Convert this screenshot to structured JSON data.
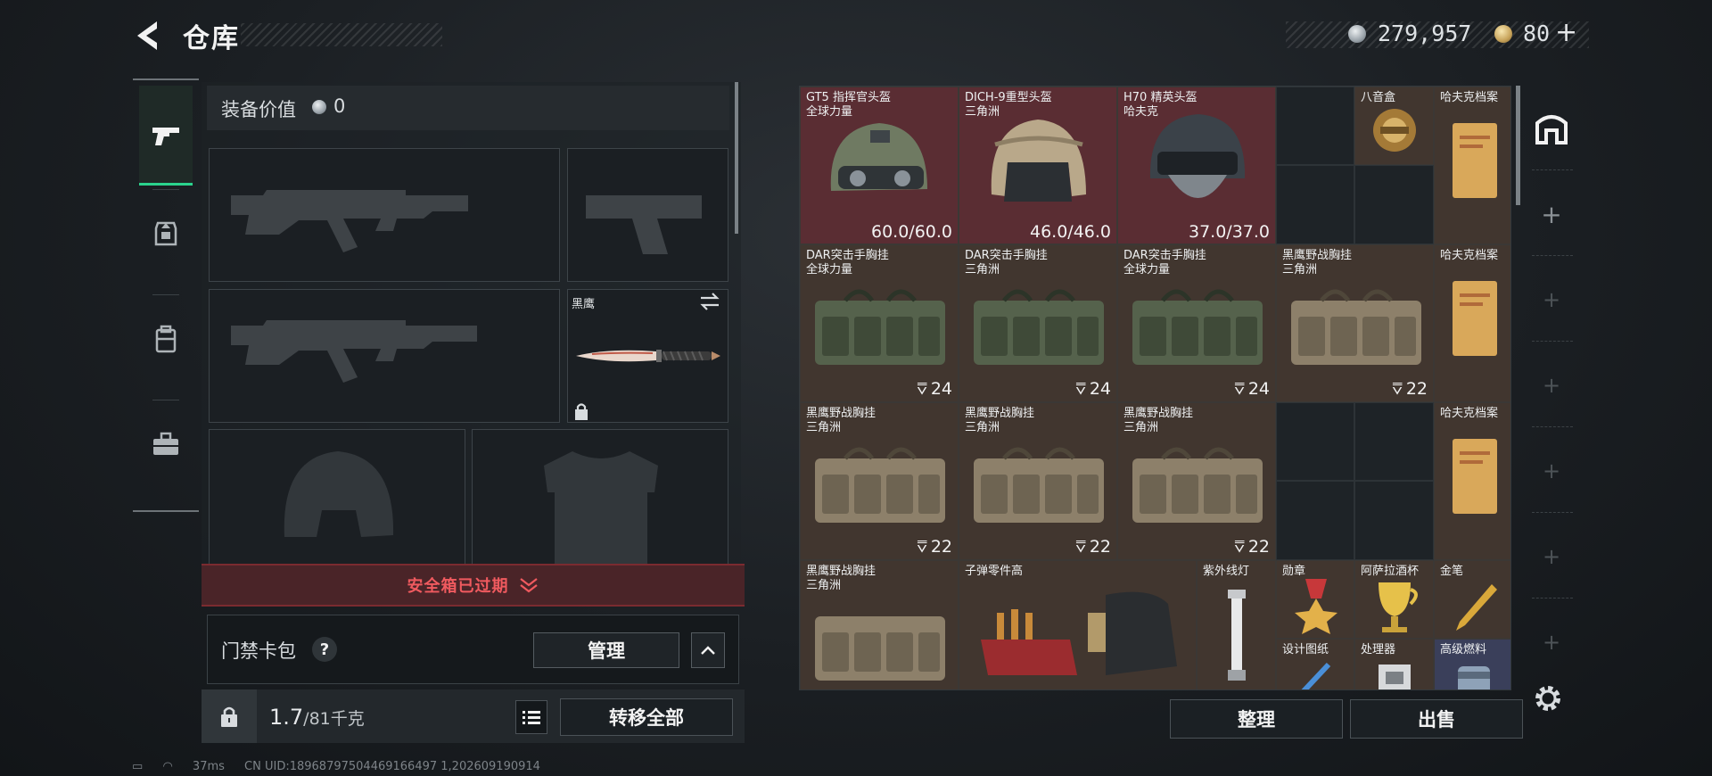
{
  "header": {
    "title": "仓库",
    "money": "279,957",
    "gold": "80"
  },
  "equipment": {
    "value_label": "装备价值",
    "value": "0",
    "knife_label": "黑鹰"
  },
  "safe_box": {
    "text": "安全箱已过期"
  },
  "keycard": {
    "label": "门禁卡包",
    "help": "?",
    "manage_label": "管理"
  },
  "weight": {
    "current": "1.7",
    "max": "/81千克"
  },
  "buttons": {
    "transfer_all": "转移全部",
    "sort": "整理",
    "sell": "出售"
  },
  "status": {
    "ping": "37ms",
    "uid": "CN UID:18968797504469166497 1,202609190914"
  },
  "stash": {
    "helmets": [
      {
        "name": "GT5 指挥官头盔",
        "sub": "全球力量",
        "durability": "60.0/60.0"
      },
      {
        "name": "DICH-9重型头盔",
        "sub": "三角洲",
        "durability": "46.0/46.0"
      },
      {
        "name": "H70 精英头盔",
        "sub": "哈夫克",
        "durability": "37.0/37.0"
      }
    ],
    "row2": [
      {
        "name": "DAR突击手胸挂",
        "sub": "全球力量",
        "count": "24",
        "tone": "green"
      },
      {
        "name": "DAR突击手胸挂",
        "sub": "三角洲",
        "count": "24",
        "tone": "green"
      },
      {
        "name": "DAR突击手胸挂",
        "sub": "全球力量",
        "count": "24",
        "tone": "green"
      },
      {
        "name": "黑鹰野战胸挂",
        "sub": "三角洲",
        "count": "22",
        "tone": "tan"
      }
    ],
    "row3": [
      {
        "name": "黑鹰野战胸挂",
        "sub": "三角洲",
        "count": "22",
        "tone": "tan"
      },
      {
        "name": "黑鹰野战胸挂",
        "sub": "三角洲",
        "count": "22",
        "tone": "tan"
      },
      {
        "name": "黑鹰野战胸挂",
        "sub": "三角洲",
        "count": "22",
        "tone": "tan"
      }
    ],
    "row4_vest": {
      "name": "黑鹰野战胸挂",
      "sub": "三角洲"
    },
    "ammo_parts": "子弹零件高",
    "uv_lamp": "紫外线灯",
    "medal": "勋章",
    "wine_cup": "阿萨拉酒杯",
    "gold_pen": "金笔",
    "design": "设计图纸",
    "processor": "处理器",
    "fuel": "高级燃料",
    "bagua": "八音盒",
    "hafk_files": [
      "哈夫克档案",
      "哈夫克档案",
      "哈夫克档案"
    ]
  }
}
